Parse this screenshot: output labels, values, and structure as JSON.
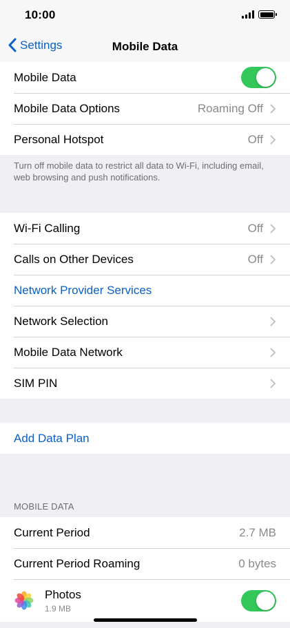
{
  "status_bar": {
    "time": "10:00"
  },
  "nav": {
    "back_label": "Settings",
    "title": "Mobile Data"
  },
  "group1": {
    "mobile_data_label": "Mobile Data",
    "mobile_data_on": true,
    "options_label": "Mobile Data Options",
    "options_value": "Roaming Off",
    "hotspot_label": "Personal Hotspot",
    "hotspot_value": "Off"
  },
  "group1_footer": "Turn off mobile data to restrict all data to Wi-Fi, including email, web browsing and push notifications.",
  "group2": {
    "wifi_calling_label": "Wi-Fi Calling",
    "wifi_calling_value": "Off",
    "calls_other_label": "Calls on Other Devices",
    "calls_other_value": "Off",
    "provider_services_label": "Network Provider Services",
    "network_selection_label": "Network Selection",
    "mobile_data_network_label": "Mobile Data Network",
    "sim_pin_label": "SIM PIN"
  },
  "group3": {
    "add_plan_label": "Add Data Plan"
  },
  "usage": {
    "section_header": "MOBILE DATA",
    "current_period_label": "Current Period",
    "current_period_value": "2.7 MB",
    "roaming_label": "Current Period Roaming",
    "roaming_value": "0 bytes",
    "apps": [
      {
        "name": "Photos",
        "size": "1.9 MB",
        "icon": "photos-icon",
        "enabled": true
      }
    ]
  },
  "colors": {
    "accent": "#0a60c8",
    "toggle_on": "#34c759",
    "background": "#efeff4"
  }
}
